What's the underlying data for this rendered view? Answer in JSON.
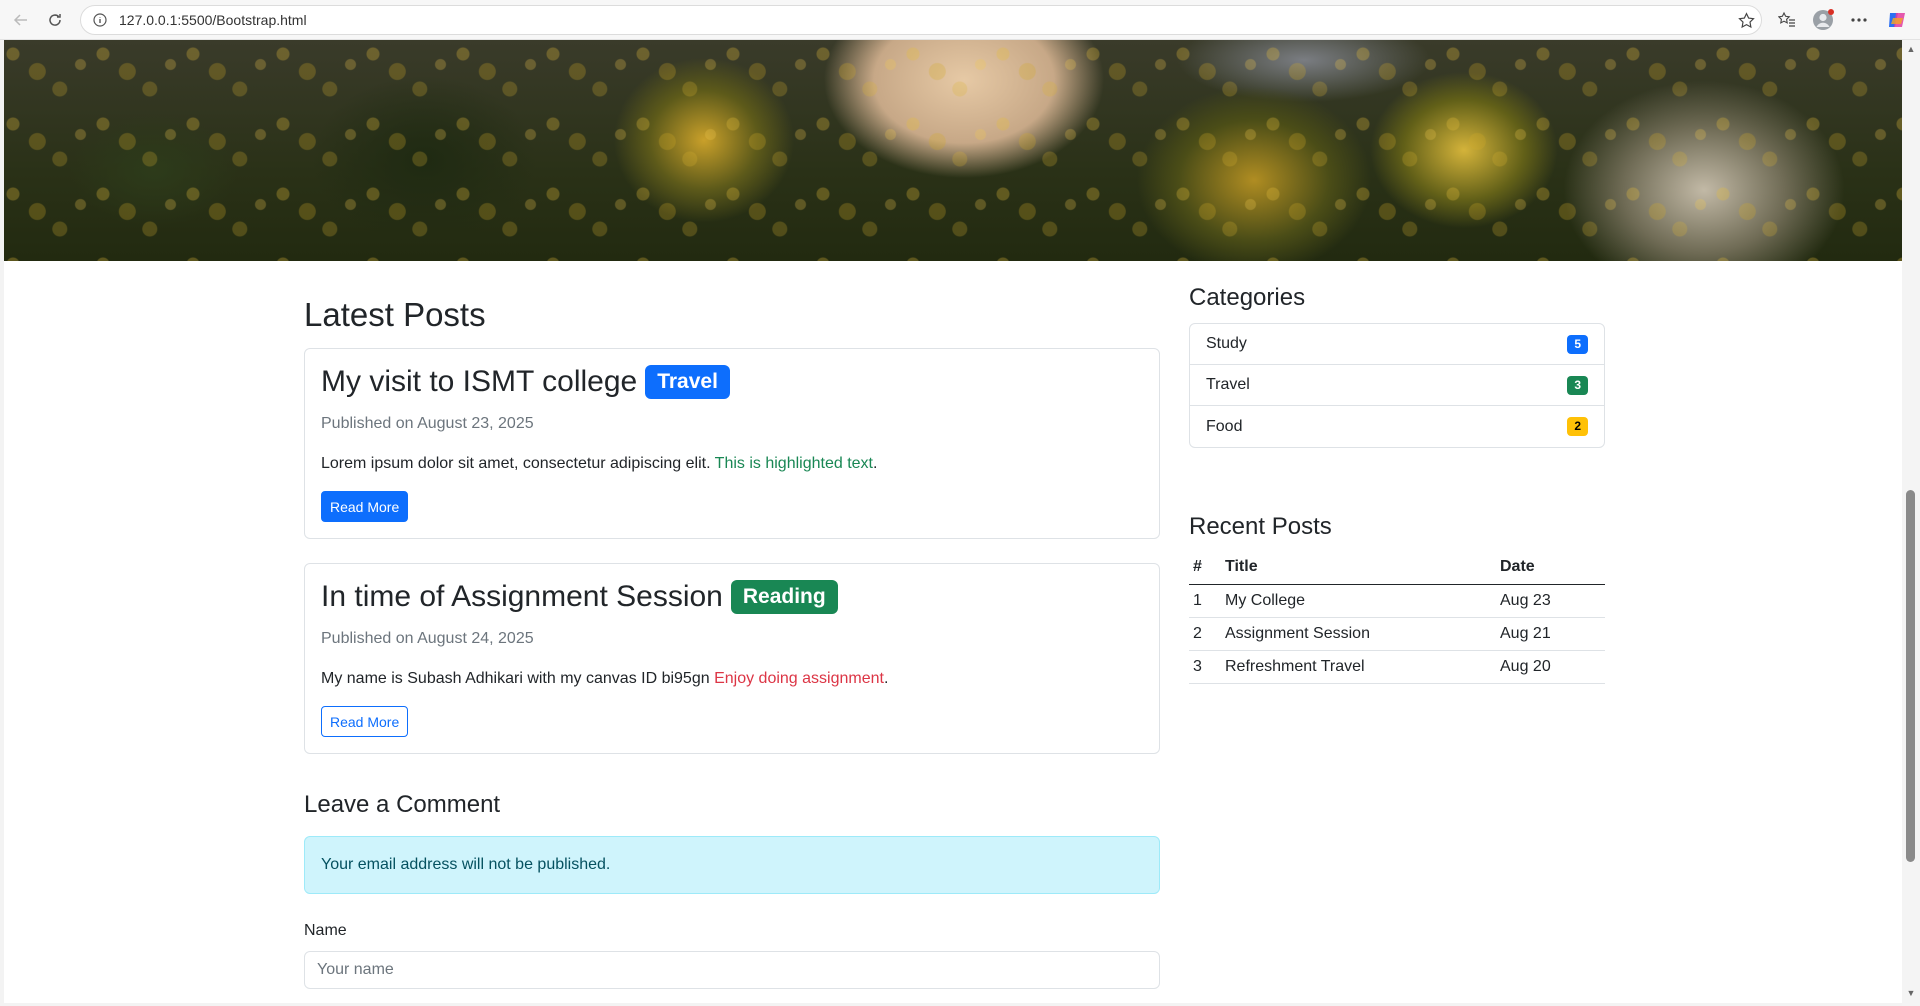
{
  "browser": {
    "url": "127.0.0.1:5500/Bootstrap.html"
  },
  "main": {
    "heading": "Latest Posts",
    "posts": [
      {
        "title": "My visit to ISMT college",
        "badge": "Travel",
        "badge_color": "#0d6efd",
        "meta": "Published on August 23, 2025",
        "text": "Lorem ipsum dolor sit amet, consectetur adipiscing elit.",
        "highlight": "This is highlighted text",
        "highlight_color": "#198754",
        "button": "Read More"
      },
      {
        "title": "In time of Assignment Session",
        "badge": "Reading",
        "badge_color": "#198754",
        "meta": "Published on August 24, 2025",
        "text": "My name is Subash Adhikari with my canvas ID bi95gn",
        "highlight": "Enjoy doing assignment",
        "highlight_color": "#dc3545",
        "button": "Read More"
      }
    ],
    "comment": {
      "heading": "Leave a Comment",
      "alert": "Your email address will not be published.",
      "name_label": "Name",
      "name_placeholder": "Your name"
    }
  },
  "sidebar": {
    "categories_heading": "Categories",
    "categories": [
      {
        "name": "Study",
        "count": "5",
        "color": "#0d6efd"
      },
      {
        "name": "Travel",
        "count": "3",
        "color": "#198754"
      },
      {
        "name": "Food",
        "count": "2",
        "color": "#ffc107"
      }
    ],
    "recent_heading": "Recent Posts",
    "table": {
      "headers": [
        "#",
        "Title",
        "Date"
      ],
      "rows": [
        [
          "1",
          "My College",
          "Aug 23"
        ],
        [
          "2",
          "Assignment Session",
          "Aug 21"
        ],
        [
          "3",
          "Refreshment Travel",
          "Aug 20"
        ]
      ]
    }
  }
}
